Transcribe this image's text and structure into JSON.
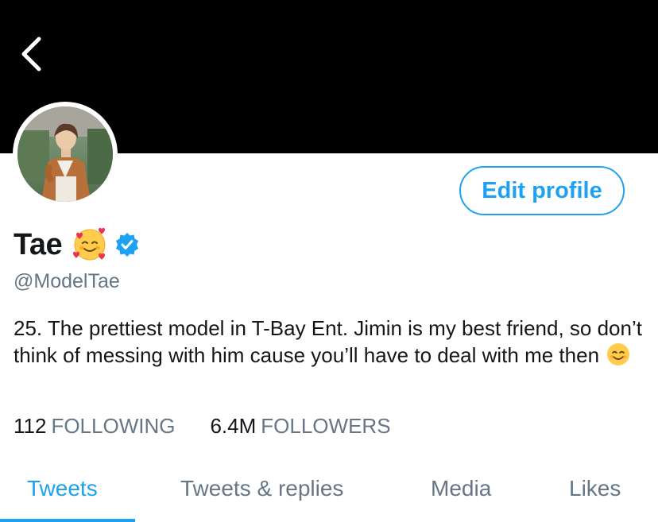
{
  "header": {
    "back_icon": "chevron-left-icon"
  },
  "profile": {
    "avatar": "avatar",
    "name": "Tae",
    "name_emoji": "smiling-face-with-hearts-icon",
    "verified_icon": "verified-badge-icon",
    "handle": "@ModelTae",
    "bio": "25. The prettiest model in T-Bay Ent. Jimin is my best friend, so don’t think of messing with him cause you’ll have to deal with me then",
    "bio_emoji": "smiling-face-icon",
    "edit_button_label": "Edit profile"
  },
  "stats": {
    "following_count": "112",
    "following_label": "FOLLOWING",
    "followers_count": "6.4M",
    "followers_label": "FOLLOWERS"
  },
  "tabs": [
    {
      "label": "Tweets",
      "active": true
    },
    {
      "label": "Tweets & replies",
      "active": false
    },
    {
      "label": "Media",
      "active": false
    },
    {
      "label": "Likes",
      "active": false
    }
  ],
  "colors": {
    "accent": "#1da1f2",
    "secondary_text": "#657786",
    "banner": "#000000"
  }
}
